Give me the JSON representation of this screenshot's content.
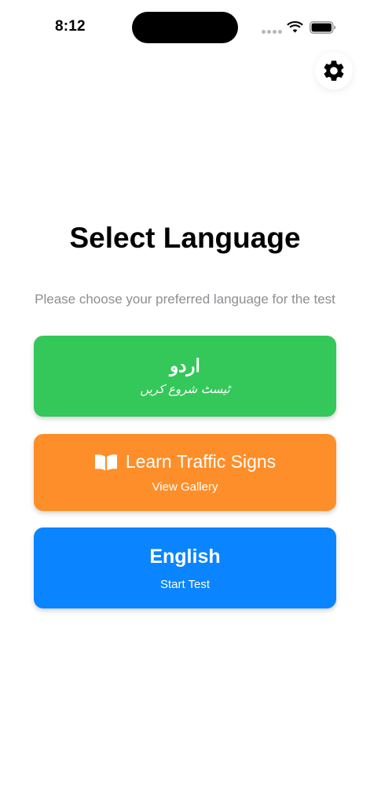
{
  "status_bar": {
    "time": "8:12"
  },
  "header": {
    "settings_icon": "gear-icon"
  },
  "main": {
    "title": "Select Language",
    "subtitle": "Please choose your preferred language for the test",
    "options": [
      {
        "id": "urdu",
        "label": "اردو",
        "sublabel": "ٹیسٹ شروع کریں",
        "color": "#34C759"
      },
      {
        "id": "signs",
        "icon": "book-icon",
        "label": "Learn Traffic Signs",
        "sublabel": "View Gallery",
        "color": "#FE8E29"
      },
      {
        "id": "english",
        "label": "English",
        "sublabel": "Start Test",
        "color": "#0A84FF"
      }
    ]
  }
}
